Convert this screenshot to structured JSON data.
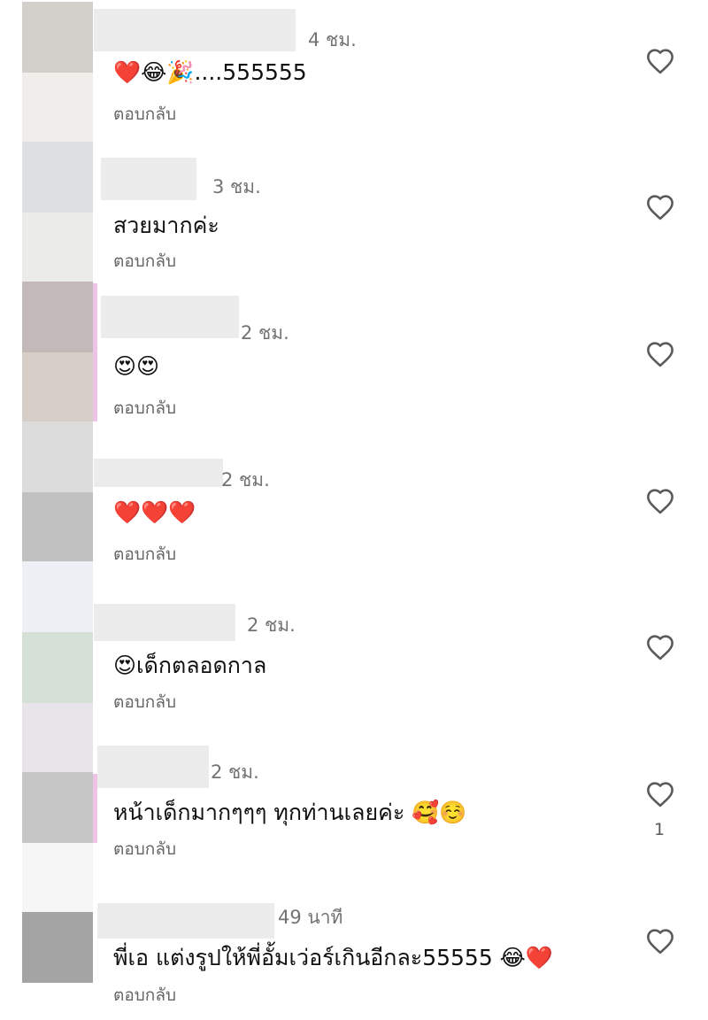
{
  "comments": [
    {
      "time": "4 ชม.",
      "text": "❤️😂🎉....555555",
      "reply": "ตอบกลับ",
      "likes": ""
    },
    {
      "time": "3 ชม.",
      "text": "สวยมากค่ะ",
      "reply": "ตอบกลับ",
      "likes": ""
    },
    {
      "time": "2 ชม.",
      "text": "😍😍",
      "reply": "ตอบกลับ",
      "likes": ""
    },
    {
      "time": "2 ชม.",
      "text": "❤️❤️❤️",
      "reply": "ตอบกลับ",
      "likes": ""
    },
    {
      "time": "2 ชม.",
      "text": "😍เด็กตลอดกาล",
      "reply": "ตอบกลับ",
      "likes": ""
    },
    {
      "time": "2 ชม.",
      "text": "หน้าเด็กมากๆๆๆ ทุกท่านเลยค่ะ 🥰☺️",
      "reply": "ตอบกลับ",
      "likes": "1"
    },
    {
      "time": "49 นาที",
      "text": "พี่เอ  แต่งรูปให้พี่อั้มเว่อร์เกินอีกละ55555 😂❤️",
      "reply": "ตอบกลับ",
      "likes": ""
    }
  ],
  "icons": {
    "like": "heart-outline-icon"
  },
  "colors": {
    "meta_text": "#737373",
    "icon": "#5a5a5a",
    "body_text": "#111111"
  }
}
